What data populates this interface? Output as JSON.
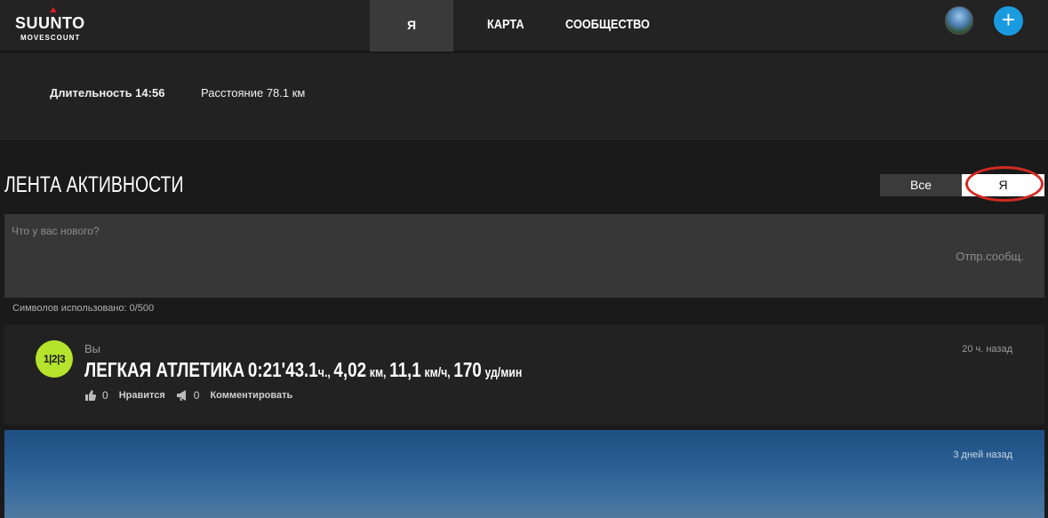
{
  "header": {
    "brand": "SUUNTO",
    "brand_sub": "MOVESCOUNT",
    "nav": [
      {
        "label": "Я",
        "active": true
      },
      {
        "label": "КАРТА",
        "active": false
      },
      {
        "label": "СООБЩЕСТВО",
        "active": false
      }
    ],
    "add_label": "+"
  },
  "summary": {
    "duration": "Длительность 14:56",
    "distance": "Расстояние 78.1 км"
  },
  "activity": {
    "title": "ЛЕНТА АКТИВНОСТИ",
    "filter_all": "Все",
    "filter_me": "Я",
    "filter_selected": "Я"
  },
  "composer": {
    "placeholder": "Что у вас нового?",
    "send_label": "Отпр.сообщ.",
    "char_count": "Символов использовано: 0/500"
  },
  "feed": [
    {
      "badge": "1|2|3",
      "user": "Вы",
      "time": "20 ч. назад",
      "title_sport": "ЛЕГКАЯ АТЛЕТИКА",
      "title_time": "0:21'43.1",
      "title_time_unit": "ч.,",
      "title_dist": "4,02",
      "title_dist_unit": "км,",
      "title_speed": "11,1",
      "title_speed_unit": "км/ч,",
      "title_hr": "170",
      "title_hr_unit": "уд/мин",
      "likes": "0",
      "like_label": "Нравится",
      "comments": "0",
      "comment_label": "Комментировать"
    },
    {
      "time": "3 дней назад"
    }
  ],
  "colors": {
    "accent_blue": "#1a9be0",
    "badge_green": "#b6e32b",
    "highlight_red": "#d42a22"
  }
}
